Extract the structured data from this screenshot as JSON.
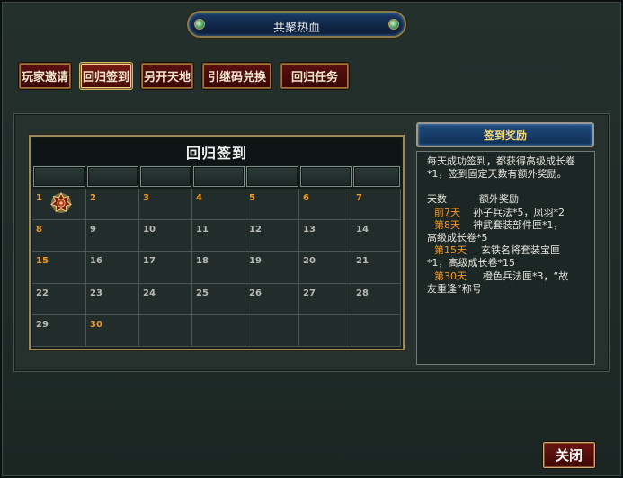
{
  "window": {
    "title": "共聚热血"
  },
  "tabs": [
    {
      "label": "玩家邀请",
      "active": false
    },
    {
      "label": "回归签到",
      "active": true
    },
    {
      "label": "另开天地",
      "active": false
    },
    {
      "label": "引继码兑换",
      "active": false
    },
    {
      "label": "回归任务",
      "active": false
    }
  ],
  "calendar": {
    "title": "回归签到",
    "days": [
      "1",
      "2",
      "3",
      "4",
      "5",
      "6",
      "7",
      "8",
      "9",
      "10",
      "11",
      "12",
      "13",
      "14",
      "15",
      "16",
      "17",
      "18",
      "19",
      "20",
      "21",
      "22",
      "23",
      "24",
      "25",
      "26",
      "27",
      "28",
      "29",
      "30"
    ],
    "highlighted_days": [
      1,
      2,
      3,
      4,
      5,
      6,
      7,
      8,
      15,
      30
    ],
    "signed_days": [
      1
    ]
  },
  "reward": {
    "header": "签到奖励",
    "intro": "每天成功签到，都获得高级成长卷*1，签到固定天数有额外奖励。",
    "col_days": "天数",
    "col_reward": "额外奖励",
    "row1_day": "前7天",
    "row1_reward": "孙子兵法*5，凤羽*2",
    "row2_day": "第8天",
    "row2_reward": "神武套装部件匣*1，",
    "row2_reward_cont": "高级成长卷*5",
    "row3_day": "第15天",
    "row3_reward": "玄铁名将套装宝匣",
    "row3_reward_cont": "*1，高级成长卷*15",
    "row4_day": "第30天",
    "row4_reward": "橙色兵法匣*3，“故",
    "row4_reward_cont": "友重逢”称号"
  },
  "buttons": {
    "close": "关闭"
  },
  "colors": {
    "gold": "#f09a28",
    "tab_red": "#5a1010",
    "header_blue": "#1f4a7a"
  }
}
